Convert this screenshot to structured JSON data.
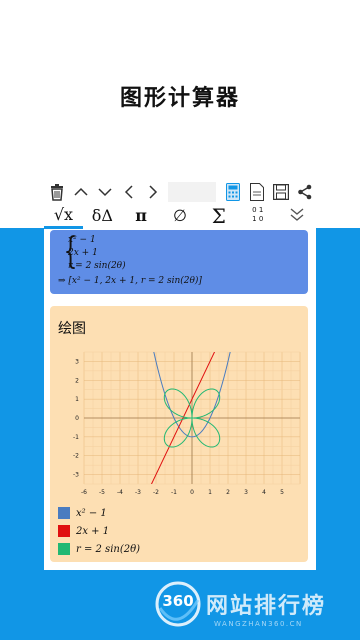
{
  "page_title": "图形计算器",
  "tabs": [
    {
      "label": "√x"
    },
    {
      "label": "δΔ"
    },
    {
      "label": "π"
    },
    {
      "label": "∅"
    },
    {
      "label": "Σ"
    }
  ],
  "toolbar_small": {
    "top": "0 1",
    "bottom": "1 0"
  },
  "expression": {
    "line1": "x² − 1",
    "line2": "2x + 1",
    "line3": "r = 2 sin(2θ)",
    "result": "⇒ [x² − 1, 2x + 1, r = 2 sin(2θ)]"
  },
  "plot": {
    "title": "绘图",
    "legend": [
      {
        "label": "x² − 1",
        "color": "#4a7cc0"
      },
      {
        "label": "2x + 1",
        "color": "#e01010"
      },
      {
        "label": "r = 2 sin(2θ)",
        "color": "#22b873"
      }
    ],
    "x_ticks": [
      "-6",
      "-5",
      "-4",
      "-3",
      "-2",
      "-1",
      "0",
      "1",
      "2",
      "3",
      "4",
      "5"
    ],
    "y_ticks": [
      "3",
      "2",
      "1",
      "0",
      "-1",
      "-2",
      "-3"
    ]
  },
  "watermark": {
    "badge": "360",
    "text": "网站排行榜",
    "url": "WANGZHAN360.CN"
  },
  "colors": {
    "accent": "#1196e6",
    "expr_bg": "#5f8de6",
    "plot_bg": "#fddfb3",
    "quadratic": "#4a7cc0",
    "linear": "#e01010",
    "polar": "#22b873"
  }
}
